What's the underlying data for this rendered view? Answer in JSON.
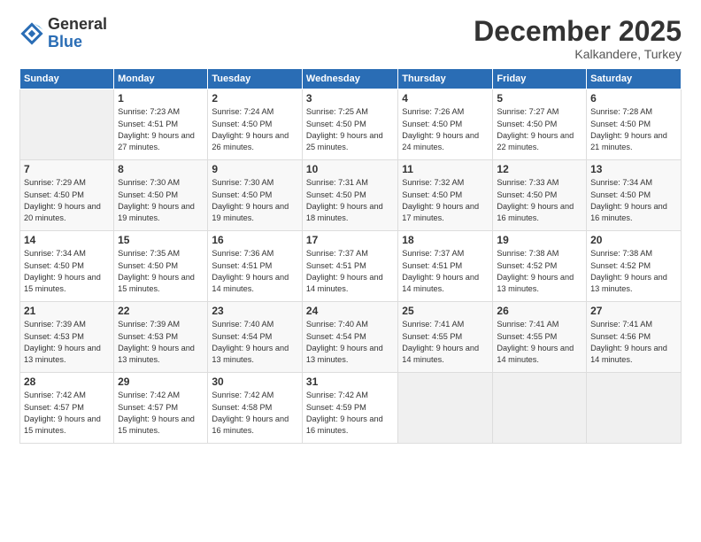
{
  "logo": {
    "general": "General",
    "blue": "Blue"
  },
  "title": "December 2025",
  "location": "Kalkandere, Turkey",
  "headers": [
    "Sunday",
    "Monday",
    "Tuesday",
    "Wednesday",
    "Thursday",
    "Friday",
    "Saturday"
  ],
  "weeks": [
    [
      {
        "day": "",
        "sunrise": "",
        "sunset": "",
        "daylight": ""
      },
      {
        "day": "1",
        "sunrise": "Sunrise: 7:23 AM",
        "sunset": "Sunset: 4:51 PM",
        "daylight": "Daylight: 9 hours and 27 minutes."
      },
      {
        "day": "2",
        "sunrise": "Sunrise: 7:24 AM",
        "sunset": "Sunset: 4:50 PM",
        "daylight": "Daylight: 9 hours and 26 minutes."
      },
      {
        "day": "3",
        "sunrise": "Sunrise: 7:25 AM",
        "sunset": "Sunset: 4:50 PM",
        "daylight": "Daylight: 9 hours and 25 minutes."
      },
      {
        "day": "4",
        "sunrise": "Sunrise: 7:26 AM",
        "sunset": "Sunset: 4:50 PM",
        "daylight": "Daylight: 9 hours and 24 minutes."
      },
      {
        "day": "5",
        "sunrise": "Sunrise: 7:27 AM",
        "sunset": "Sunset: 4:50 PM",
        "daylight": "Daylight: 9 hours and 22 minutes."
      },
      {
        "day": "6",
        "sunrise": "Sunrise: 7:28 AM",
        "sunset": "Sunset: 4:50 PM",
        "daylight": "Daylight: 9 hours and 21 minutes."
      }
    ],
    [
      {
        "day": "7",
        "sunrise": "Sunrise: 7:29 AM",
        "sunset": "Sunset: 4:50 PM",
        "daylight": "Daylight: 9 hours and 20 minutes."
      },
      {
        "day": "8",
        "sunrise": "Sunrise: 7:30 AM",
        "sunset": "Sunset: 4:50 PM",
        "daylight": "Daylight: 9 hours and 19 minutes."
      },
      {
        "day": "9",
        "sunrise": "Sunrise: 7:30 AM",
        "sunset": "Sunset: 4:50 PM",
        "daylight": "Daylight: 9 hours and 19 minutes."
      },
      {
        "day": "10",
        "sunrise": "Sunrise: 7:31 AM",
        "sunset": "Sunset: 4:50 PM",
        "daylight": "Daylight: 9 hours and 18 minutes."
      },
      {
        "day": "11",
        "sunrise": "Sunrise: 7:32 AM",
        "sunset": "Sunset: 4:50 PM",
        "daylight": "Daylight: 9 hours and 17 minutes."
      },
      {
        "day": "12",
        "sunrise": "Sunrise: 7:33 AM",
        "sunset": "Sunset: 4:50 PM",
        "daylight": "Daylight: 9 hours and 16 minutes."
      },
      {
        "day": "13",
        "sunrise": "Sunrise: 7:34 AM",
        "sunset": "Sunset: 4:50 PM",
        "daylight": "Daylight: 9 hours and 16 minutes."
      }
    ],
    [
      {
        "day": "14",
        "sunrise": "Sunrise: 7:34 AM",
        "sunset": "Sunset: 4:50 PM",
        "daylight": "Daylight: 9 hours and 15 minutes."
      },
      {
        "day": "15",
        "sunrise": "Sunrise: 7:35 AM",
        "sunset": "Sunset: 4:50 PM",
        "daylight": "Daylight: 9 hours and 15 minutes."
      },
      {
        "day": "16",
        "sunrise": "Sunrise: 7:36 AM",
        "sunset": "Sunset: 4:51 PM",
        "daylight": "Daylight: 9 hours and 14 minutes."
      },
      {
        "day": "17",
        "sunrise": "Sunrise: 7:37 AM",
        "sunset": "Sunset: 4:51 PM",
        "daylight": "Daylight: 9 hours and 14 minutes."
      },
      {
        "day": "18",
        "sunrise": "Sunrise: 7:37 AM",
        "sunset": "Sunset: 4:51 PM",
        "daylight": "Daylight: 9 hours and 14 minutes."
      },
      {
        "day": "19",
        "sunrise": "Sunrise: 7:38 AM",
        "sunset": "Sunset: 4:52 PM",
        "daylight": "Daylight: 9 hours and 13 minutes."
      },
      {
        "day": "20",
        "sunrise": "Sunrise: 7:38 AM",
        "sunset": "Sunset: 4:52 PM",
        "daylight": "Daylight: 9 hours and 13 minutes."
      }
    ],
    [
      {
        "day": "21",
        "sunrise": "Sunrise: 7:39 AM",
        "sunset": "Sunset: 4:53 PM",
        "daylight": "Daylight: 9 hours and 13 minutes."
      },
      {
        "day": "22",
        "sunrise": "Sunrise: 7:39 AM",
        "sunset": "Sunset: 4:53 PM",
        "daylight": "Daylight: 9 hours and 13 minutes."
      },
      {
        "day": "23",
        "sunrise": "Sunrise: 7:40 AM",
        "sunset": "Sunset: 4:54 PM",
        "daylight": "Daylight: 9 hours and 13 minutes."
      },
      {
        "day": "24",
        "sunrise": "Sunrise: 7:40 AM",
        "sunset": "Sunset: 4:54 PM",
        "daylight": "Daylight: 9 hours and 13 minutes."
      },
      {
        "day": "25",
        "sunrise": "Sunrise: 7:41 AM",
        "sunset": "Sunset: 4:55 PM",
        "daylight": "Daylight: 9 hours and 14 minutes."
      },
      {
        "day": "26",
        "sunrise": "Sunrise: 7:41 AM",
        "sunset": "Sunset: 4:55 PM",
        "daylight": "Daylight: 9 hours and 14 minutes."
      },
      {
        "day": "27",
        "sunrise": "Sunrise: 7:41 AM",
        "sunset": "Sunset: 4:56 PM",
        "daylight": "Daylight: 9 hours and 14 minutes."
      }
    ],
    [
      {
        "day": "28",
        "sunrise": "Sunrise: 7:42 AM",
        "sunset": "Sunset: 4:57 PM",
        "daylight": "Daylight: 9 hours and 15 minutes."
      },
      {
        "day": "29",
        "sunrise": "Sunrise: 7:42 AM",
        "sunset": "Sunset: 4:57 PM",
        "daylight": "Daylight: 9 hours and 15 minutes."
      },
      {
        "day": "30",
        "sunrise": "Sunrise: 7:42 AM",
        "sunset": "Sunset: 4:58 PM",
        "daylight": "Daylight: 9 hours and 16 minutes."
      },
      {
        "day": "31",
        "sunrise": "Sunrise: 7:42 AM",
        "sunset": "Sunset: 4:59 PM",
        "daylight": "Daylight: 9 hours and 16 minutes."
      },
      {
        "day": "",
        "sunrise": "",
        "sunset": "",
        "daylight": ""
      },
      {
        "day": "",
        "sunrise": "",
        "sunset": "",
        "daylight": ""
      },
      {
        "day": "",
        "sunrise": "",
        "sunset": "",
        "daylight": ""
      }
    ]
  ]
}
